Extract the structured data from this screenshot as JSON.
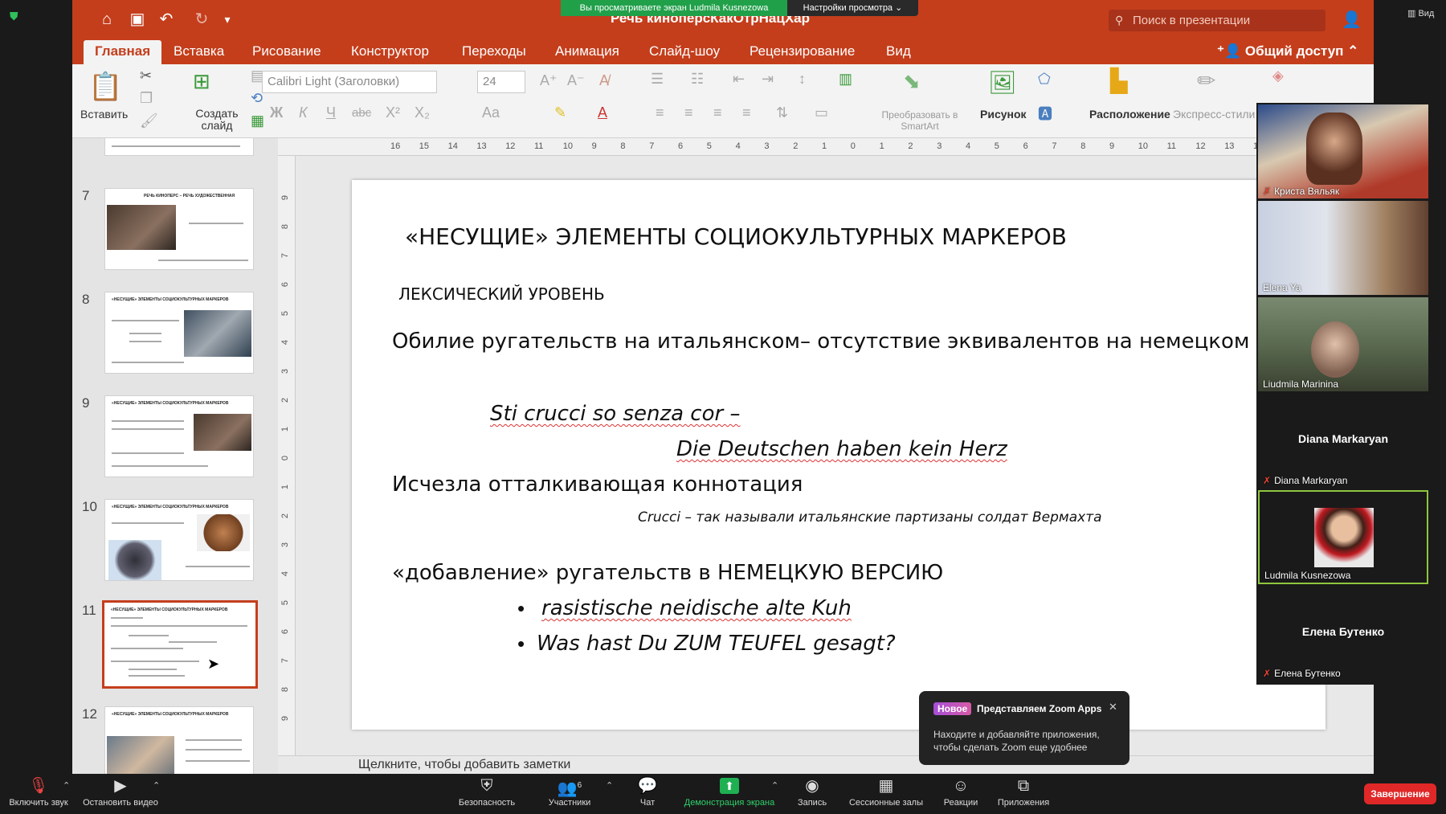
{
  "zoom": {
    "viewing_banner": "Вы просматриваете экран Ludmila Kusnezowa",
    "view_options": "Настройки просмотра ⌄",
    "view_tag": "▥ Вид",
    "toolbar": {
      "mute": "Включить звук",
      "video": "Остановить видео",
      "security": "Безопасность",
      "participants": "Участники",
      "participants_count": "6",
      "chat": "Чат",
      "share": "Демонстрация экрана",
      "record": "Запись",
      "breakout": "Сессионные залы",
      "reactions": "Реакции",
      "apps": "Приложения",
      "end": "Завершение"
    },
    "popup": {
      "badge": "Новое",
      "title": "Представляем Zoom Apps",
      "body": "Находите и добавляйте приложения, чтобы сделать Zoom еще удобнее"
    },
    "participants": [
      {
        "name": "Криста Вяльяк",
        "muted": true
      },
      {
        "name": "Elena Ya",
        "muted": false
      },
      {
        "name": "Liudmila Marinina",
        "muted": false
      },
      {
        "name": "Diana Markaryan",
        "big": "Diana Markaryan",
        "muted": true
      },
      {
        "name": "Ludmila Kusnezowa",
        "muted": false
      },
      {
        "name": "Елена Бутенко",
        "big": "Елена Бутенко",
        "muted": true
      }
    ]
  },
  "ppt": {
    "doc_title": "Речь киноперсКакОтрНацХар",
    "search_placeholder": "Поиск в презентации",
    "menu": [
      "Главная",
      "Вставка",
      "Рисование",
      "Конструктор",
      "Переходы",
      "Анимация",
      "Слайд-шоу",
      "Рецензирование",
      "Вид"
    ],
    "share": "Общий доступ",
    "ribbon": {
      "paste": "Вставить",
      "new_slide": "Создать слайд",
      "font": "Calibri Light (Заголовки)",
      "size": "24",
      "smartart": "Преобразовать в SmartArt",
      "picture": "Рисунок",
      "arrange": "Расположение",
      "quick_styles": "Экспресс-стили"
    },
    "ruler_top": [
      "16",
      "15",
      "14",
      "13",
      "12",
      "11",
      "10",
      "9",
      "8",
      "7",
      "6",
      "5",
      "4",
      "3",
      "2",
      "1",
      "0",
      "1",
      "2",
      "3",
      "4",
      "5",
      "6",
      "7",
      "8",
      "9",
      "10",
      "11",
      "12",
      "13",
      "14"
    ],
    "ruler_left": [
      "9",
      "8",
      "7",
      "6",
      "5",
      "4",
      "3",
      "2",
      "1",
      "0",
      "1",
      "2",
      "3",
      "4",
      "5",
      "6",
      "7",
      "8",
      "9"
    ],
    "thumbnails": [
      {
        "num": "7",
        "title": "РЕЧЬ КИНОПЕРС – РЕЧЬ ХУДОЖЕСТВЕННАЯ"
      },
      {
        "num": "8",
        "title": "«НЕСУЩИЕ» ЭЛЕМЕНТЫ СОЦИОКУЛЬТУРНЫХ МАРКЕРОВ"
      },
      {
        "num": "9",
        "title": "«НЕСУЩИЕ» ЭЛЕМЕНТЫ СОЦИОКУЛЬТУРНЫХ МАРКЕРОВ"
      },
      {
        "num": "10",
        "title": "«НЕСУЩИЕ» ЭЛЕМЕНТЫ СОЦИОКУЛЬТУРНЫХ МАРКЕРОВ"
      },
      {
        "num": "11",
        "title": "«НЕСУЩИЕ» ЭЛЕМЕНТЫ СОЦИОКУЛЬТУРНЫХ МАРКЕРОВ"
      },
      {
        "num": "12",
        "title": "«НЕСУЩИЕ» ЭЛЕМЕНТЫ СОЦИОКУЛЬТУРНЫХ МАРКЕРОВ"
      }
    ],
    "slide": {
      "title": "«НЕСУЩИЕ» ЭЛЕМЕНТЫ СОЦИОКУЛЬТУРНЫХ МАРКЕРОВ",
      "subtitle": "ЛЕКСИЧЕСКИЙ УРОВЕНЬ",
      "line1": "Обилие ругательств на итальянском– отсутствие эквивалентов на немецком",
      "it1": "Sti crucci so senza cor –",
      "it2": "Die Deutschen haben kein Herz",
      "line2": "Исчезла отталкивающая коннотация",
      "note": "Crucci – так называли итальянские партизаны солдат Вермахта",
      "line3": "«добавление» ругательств в НЕМЕЦКУЮ ВЕРСИЮ",
      "bullet1": "rasistische neidische alte Kuh",
      "bullet2": "Was hast Du ZUM TEUFEL gesagt?"
    },
    "notes": "Щелкните, чтобы добавить заметки"
  }
}
